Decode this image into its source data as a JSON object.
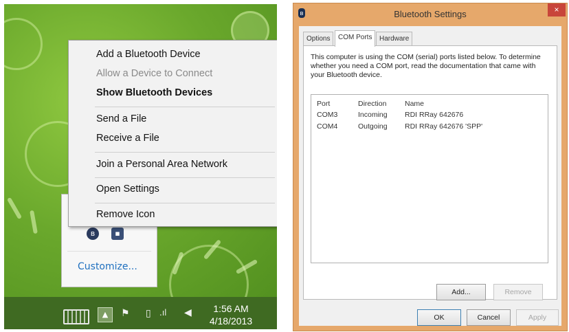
{
  "context_menu": {
    "items": [
      {
        "label": "Add a Bluetooth Device",
        "state": "normal"
      },
      {
        "label": "Allow a Device to Connect",
        "state": "disabled"
      },
      {
        "label": "Show Bluetooth Devices",
        "state": "bold"
      },
      {
        "label": "Send a File",
        "state": "normal"
      },
      {
        "label": "Receive a File",
        "state": "normal"
      },
      {
        "label": "Join a Personal Area Network",
        "state": "normal"
      },
      {
        "label": "Open Settings",
        "state": "normal"
      },
      {
        "label": "Remove Icon",
        "state": "normal"
      }
    ]
  },
  "tray_flyout": {
    "customize_label": "Customize...",
    "icons": [
      "bluetooth-icon",
      "app-icon"
    ]
  },
  "taskbar": {
    "icons": [
      "keyboard-icon",
      "show-hidden-icons-icon",
      "flag-icon",
      "battery-icon",
      "signal-icon",
      "volume-icon"
    ],
    "time": "1:56 AM",
    "date": "4/18/2013"
  },
  "dialog": {
    "title": "Bluetooth Settings",
    "close_label": "×",
    "tabs": [
      "Options",
      "COM Ports",
      "Hardware"
    ],
    "active_tab": "COM Ports",
    "description": "This computer is using the COM (serial) ports listed below. To determine whether you need a COM port, read the documentation that came with your Bluetooth device.",
    "columns": [
      "Port",
      "Direction",
      "Name"
    ],
    "ports": [
      {
        "port": "COM3",
        "direction": "Incoming",
        "name": "RDI RRay 642676"
      },
      {
        "port": "COM4",
        "direction": "Outgoing",
        "name": "RDI RRay 642676 'SPP'"
      }
    ],
    "add_label": "Add...",
    "remove_label": "Remove",
    "ok_label": "OK",
    "cancel_label": "Cancel",
    "apply_label": "Apply"
  },
  "colors": {
    "desktop_green": "#6aa82c",
    "title_bar_orange": "#e6a86b",
    "close_red": "#c8453a",
    "link_blue": "#1e6fbf"
  }
}
